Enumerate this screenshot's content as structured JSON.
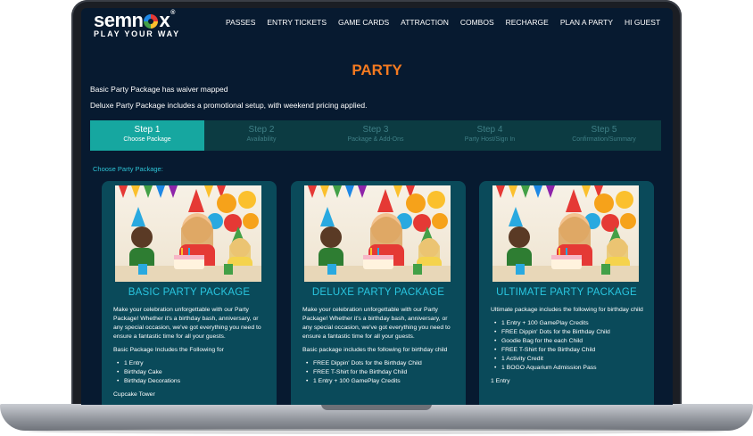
{
  "header": {
    "logo_main": "semn",
    "logo_end": "x",
    "logo_reg": "®",
    "logo_tagline": "PLAY YOUR WAY",
    "nav": [
      "PASSES",
      "ENTRY TICKETS",
      "GAME CARDS",
      "ATTRACTION",
      "COMBOS",
      "RECHARGE",
      "PLAN A PARTY",
      "HI GUEST"
    ]
  },
  "page": {
    "title": "PARTY",
    "notice1": "Basic Party Package has waiver mapped",
    "notice2": "Deluxe Party Package includes a promotional setup, with weekend pricing applied.",
    "choose_label": "Choose Party Package:"
  },
  "steps": [
    {
      "num": "Step 1",
      "label": "Choose Package"
    },
    {
      "num": "Step 2",
      "label": "Availability"
    },
    {
      "num": "Step 3",
      "label": "Package & Add-Ons"
    },
    {
      "num": "Step 4",
      "label": "Party Host/Sign In"
    },
    {
      "num": "Step 5",
      "label": "Confirmation/Summary"
    }
  ],
  "cards": [
    {
      "title": "BASIC PARTY PACKAGE",
      "intro": "Make your celebration unforgettable with our Party Package! Whether it's a birthday bash, anniversary, or any special occasion, we've got everything you need to ensure a fantastic time for all your guests.",
      "heading": "Basic Package Includes the Following for",
      "items": [
        "1 Entry",
        "Birthday Cake",
        "Birthday Decorations"
      ],
      "extra": "Cupcake Tower"
    },
    {
      "title": "DELUXE PARTY PACKAGE",
      "intro": "Make your celebration unforgettable with our Party Package! Whether it's a birthday bash, anniversary, or any special occasion, we've got everything you need to ensure a fantastic time for all your guests.",
      "heading": "Basic package includes the following for birthday child",
      "items": [
        "FREE Dippin' Dots for the Birthday Child",
        "FREE T-Shirt for the Birthday Child",
        "1 Entry + 100 GamePlay Credits"
      ]
    },
    {
      "title": "ULTIMATE PARTY PACKAGE",
      "heading": "Ultimate package includes the following for birthday child",
      "items": [
        "1 Entry + 100 GamePlay Credits",
        "FREE Dippin' Dots for the Birthday Child",
        "Goodie Bag for the each Child",
        "FREE T-Shirt for the Birthday Child",
        "1 Activity Credit",
        "1 BOGO Aquarium Admission Pass"
      ],
      "extra": "1 Entry"
    }
  ],
  "colors": {
    "screen_bg": "#071a30",
    "accent_orange": "#f47a20",
    "accent_teal": "#16a7a0",
    "card_bg": "#0a4a5a",
    "card_title": "#29c6e0"
  }
}
